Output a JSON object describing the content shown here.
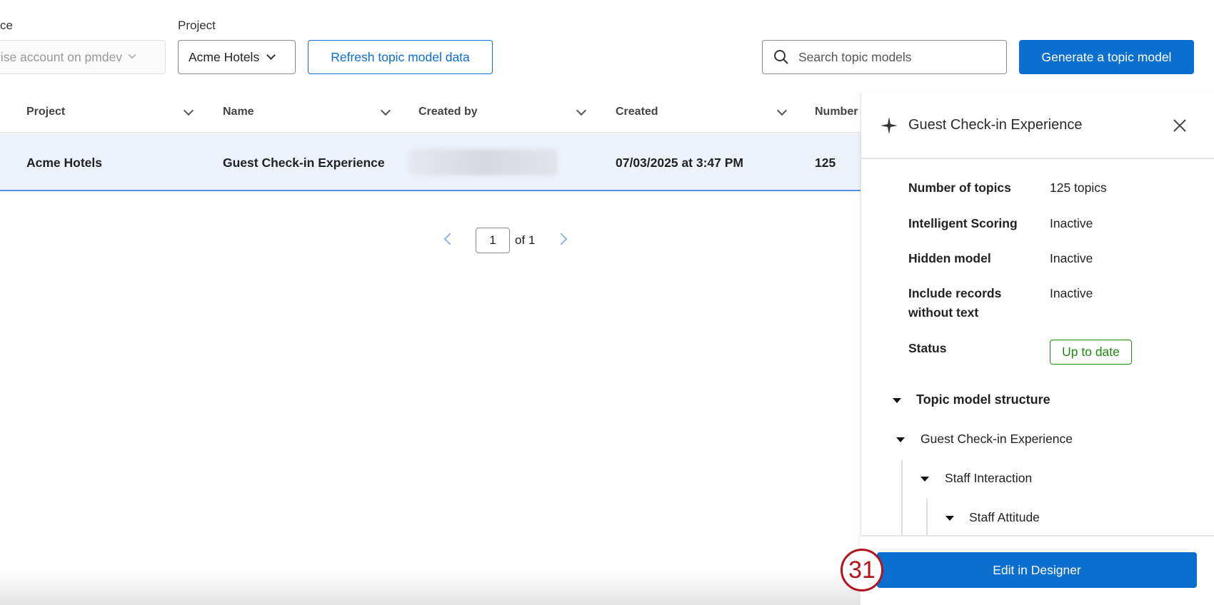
{
  "filters": {
    "source_label": "ce",
    "source_value": "rise account on pmdev",
    "project_label": "Project",
    "project_value": "Acme Hotels"
  },
  "toolbar": {
    "refresh": "Refresh topic model data",
    "search_placeholder": "Search topic models",
    "generate": "Generate a topic model"
  },
  "table": {
    "columns": [
      "Project",
      "Name",
      "Created by",
      "Created",
      "Number"
    ],
    "rows": [
      {
        "project": "Acme Hotels",
        "name": "Guest Check-in Experience",
        "created_by": "",
        "created": "07/03/2025 at 3:47 PM",
        "number": "125"
      }
    ]
  },
  "pagination": {
    "page": "1",
    "of": "of 1"
  },
  "panel": {
    "title": "Guest Check-in Experience",
    "details": [
      {
        "label": "Number of topics",
        "value": "125 topics"
      },
      {
        "label": "Intelligent Scoring",
        "value": "Inactive"
      },
      {
        "label": "Hidden model",
        "value": "Inactive"
      },
      {
        "label": "Include records without text",
        "value": "Inactive"
      },
      {
        "label": "Status",
        "value": "Up to date"
      }
    ],
    "structure_label": "Topic model structure",
    "tree": [
      "Guest Check-in Experience",
      "Staff Interaction",
      "Staff Attitude"
    ],
    "edit": "Edit in Designer"
  },
  "step_badge": "31",
  "colors": {
    "primary": "#0b6fd0",
    "status_green": "#1e8a0e",
    "row_selected": "#eef2fb",
    "badge_red": "#b5121b"
  }
}
